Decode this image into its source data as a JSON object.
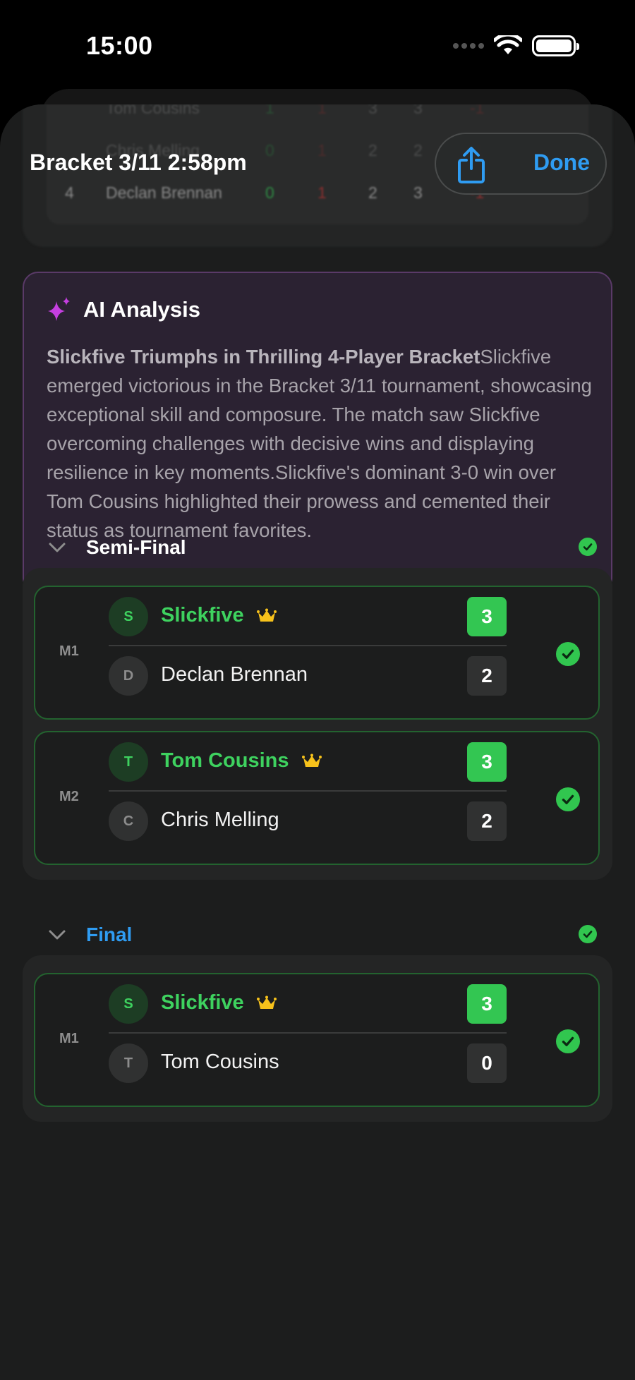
{
  "status_bar": {
    "time": "15:00"
  },
  "header": {
    "title": "Bracket 3/11 2:58pm",
    "done_label": "Done"
  },
  "standings_visible": [
    {
      "rank": "",
      "name": "Tom Cousins",
      "w": "1",
      "l": "1",
      "p": "3",
      "s": "3",
      "d": "-1"
    },
    {
      "rank": "",
      "name": "Chris Melling",
      "w": "0",
      "l": "1",
      "p": "2",
      "s": "2",
      "d": "-1"
    },
    {
      "rank": "4",
      "name": "Declan Brennan",
      "w": "0",
      "l": "1",
      "p": "2",
      "s": "3",
      "d": "-1"
    }
  ],
  "ai_analysis": {
    "title": "AI Analysis",
    "headline": "Slickfive Triumphs in Thrilling 4-Player Bracket",
    "body": "Slickfive emerged victorious in the Bracket 3/11 tournament, showcasing exceptional skill and composure. The match saw Slickfive overcoming challenges with decisive wins and displaying resilience in key moments.Slickfive's dominant 3-0 win over Tom Cousins highlighted their prowess and cemented their status as tournament favorites."
  },
  "rounds": [
    {
      "title": "Semi-Final",
      "title_color": "#ffffff",
      "matches": [
        {
          "label": "M1",
          "winner": {
            "initial": "S",
            "name": "Slickfive",
            "score": "3"
          },
          "loser": {
            "initial": "D",
            "name": "Declan Brennan",
            "score": "2"
          }
        },
        {
          "label": "M2",
          "winner": {
            "initial": "T",
            "name": "Tom Cousins",
            "score": "3"
          },
          "loser": {
            "initial": "C",
            "name": "Chris Melling",
            "score": "2"
          }
        }
      ]
    },
    {
      "title": "Final",
      "title_color": "#2f9cf2",
      "matches": [
        {
          "label": "M1",
          "winner": {
            "initial": "S",
            "name": "Slickfive",
            "score": "3"
          },
          "loser": {
            "initial": "T",
            "name": "Tom Cousins",
            "score": "0"
          }
        }
      ]
    }
  ],
  "colors": {
    "accent_blue": "#2f9cf2",
    "win_green": "#3ed25f",
    "crown_gold": "#f7c21b",
    "ai_purple": "#c53fe0"
  },
  "icons": [
    "wifi-icon",
    "battery-icon",
    "share-icon",
    "sparkles-icon",
    "chevron-down-icon",
    "checkmark-circle-icon",
    "crown-icon"
  ]
}
